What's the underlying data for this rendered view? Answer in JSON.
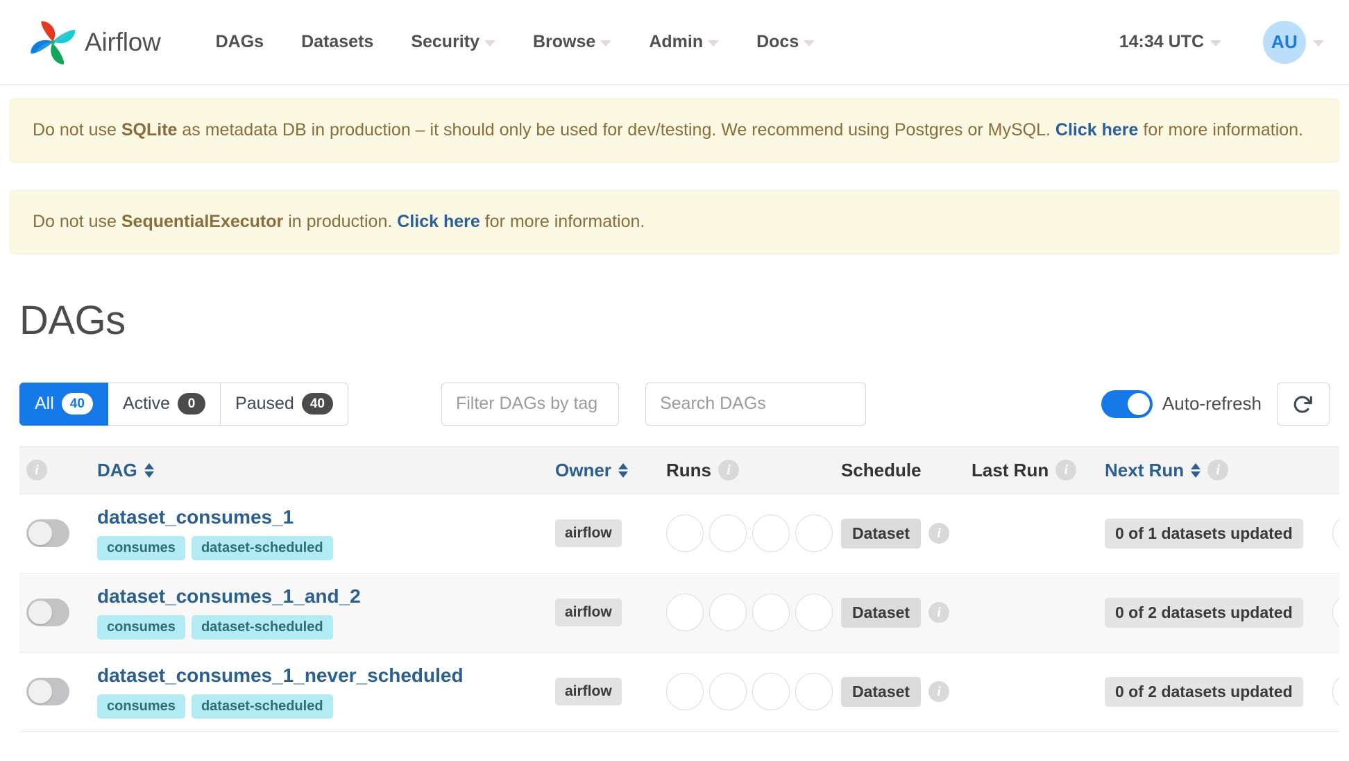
{
  "navbar": {
    "brand": "Airflow",
    "links": [
      {
        "label": "DAGs",
        "has_caret": false
      },
      {
        "label": "Datasets",
        "has_caret": false
      },
      {
        "label": "Security",
        "has_caret": true
      },
      {
        "label": "Browse",
        "has_caret": true
      },
      {
        "label": "Admin",
        "has_caret": true
      },
      {
        "label": "Docs",
        "has_caret": true
      }
    ],
    "time": "14:34 UTC",
    "avatar_initials": "AU"
  },
  "alerts": [
    {
      "part1": "Do not use ",
      "strong": "SQLite",
      "part2": " as metadata DB in production – it should only be used for dev/testing. We recommend using Postgres or MySQL. ",
      "link": "Click here",
      "part3": " for more information."
    },
    {
      "part1": "Do not use ",
      "strong": "SequentialExecutor",
      "part2": " in production. ",
      "link": "Click here",
      "part3": " for more information."
    }
  ],
  "page": {
    "title": "DAGs"
  },
  "toolbar": {
    "tabs": [
      {
        "label": "All",
        "count": "40",
        "active": true
      },
      {
        "label": "Active",
        "count": "0",
        "active": false
      },
      {
        "label": "Paused",
        "count": "40",
        "active": false
      }
    ],
    "tag_filter_placeholder": "Filter DAGs by tag",
    "search_placeholder": "Search DAGs",
    "auto_refresh_label": "Auto-refresh",
    "auto_refresh_on": true,
    "refresh_icon": "refresh-icon"
  },
  "table": {
    "headers": {
      "info": "i",
      "dag": "DAG",
      "owner": "Owner",
      "runs": "Runs",
      "schedule": "Schedule",
      "last_run": "Last Run",
      "next_run": "Next Run"
    },
    "rows": [
      {
        "name": "dataset_consumes_1",
        "paused": true,
        "tags": [
          "consumes",
          "dataset-scheduled"
        ],
        "owner": "airflow",
        "runs": 4,
        "schedule": "Dataset",
        "last_run": "",
        "next_run": "0 of 1 datasets updated"
      },
      {
        "name": "dataset_consumes_1_and_2",
        "paused": true,
        "tags": [
          "consumes",
          "dataset-scheduled"
        ],
        "owner": "airflow",
        "runs": 4,
        "schedule": "Dataset",
        "last_run": "",
        "next_run": "0 of 2 datasets updated"
      },
      {
        "name": "dataset_consumes_1_never_scheduled",
        "paused": true,
        "tags": [
          "consumes",
          "dataset-scheduled"
        ],
        "owner": "airflow",
        "runs": 4,
        "schedule": "Dataset",
        "last_run": "",
        "next_run": "0 of 2 datasets updated"
      }
    ]
  },
  "colors": {
    "accent_blue": "#1579e8",
    "link_blue": "#2a5f8f",
    "alert_bg": "#fbf8e3",
    "alert_text": "#8a6d3b",
    "tag_bg": "#b2ebf2"
  }
}
